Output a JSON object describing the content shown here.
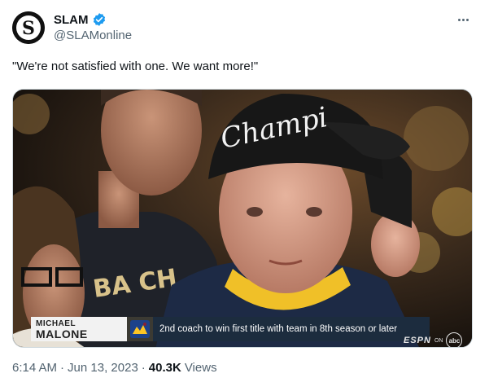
{
  "author": {
    "display_name": "SLAM",
    "handle": "@SLAMonline",
    "verified": true,
    "avatar_letter": "S"
  },
  "tweet": {
    "text": "\"We're not satisfied with one. We want more!\""
  },
  "media": {
    "cap_text": "Champi",
    "shirt_text": "BA CH",
    "lower_third": {
      "first_name": "MICHAEL",
      "last_name": "MALONE",
      "caption": "2nd coach to win first title with team in 8th season or later"
    },
    "network_bug": {
      "espn": "ESPN",
      "on": "ON",
      "abc": "abc"
    }
  },
  "meta": {
    "time": "6:14 AM",
    "date": "Jun 13, 2023",
    "views_count": "40.3K",
    "views_label": "Views"
  },
  "colors": {
    "text_primary": "#0f1419",
    "text_secondary": "#536471",
    "verified_blue": "#1d9bf0",
    "caption_bar": "#1c2c3e"
  },
  "icons": [
    "verified-badge-icon",
    "more-options-icon",
    "nuggets-logo-icon"
  ]
}
